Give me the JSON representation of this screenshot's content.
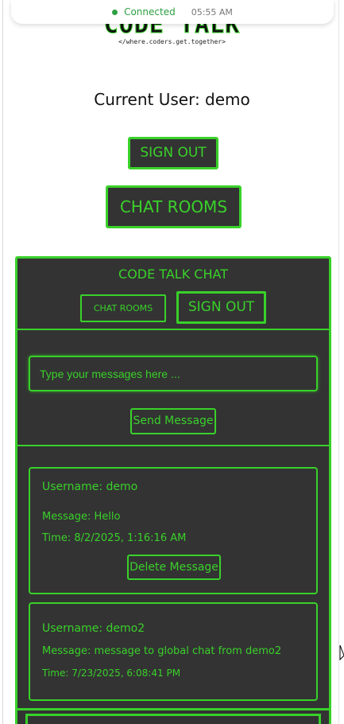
{
  "status": {
    "text": "Connected",
    "time": "05:55 AM"
  },
  "logo": {
    "title": "CODE TALK",
    "subtitle": "</where.coders.get.together>"
  },
  "current_user": "Current User: demo",
  "top_buttons": {
    "sign_out": "SIGN OUT",
    "chat_rooms": "CHAT ROOMS"
  },
  "chat": {
    "title": "CODE TALK CHAT",
    "rooms_button": "CHAT ROOMS",
    "signout_button": "SIGN OUT",
    "input_placeholder": "Type your messages here ...",
    "send_button": "Send Message",
    "messages": [
      {
        "username": "Username: demo",
        "message": "Message: Hello",
        "time": "Time: 8/2/2025, 1:16:16 AM",
        "delete_label": "Delete Message"
      },
      {
        "username": "Username: demo2",
        "message": "Message: message to global chat from demo2",
        "time": "Time: 7/23/2025, 6:08:41 PM"
      }
    ]
  },
  "colors": {
    "accent": "#39d12a",
    "panel_bg": "#333333",
    "status_green": "#2ea043"
  }
}
